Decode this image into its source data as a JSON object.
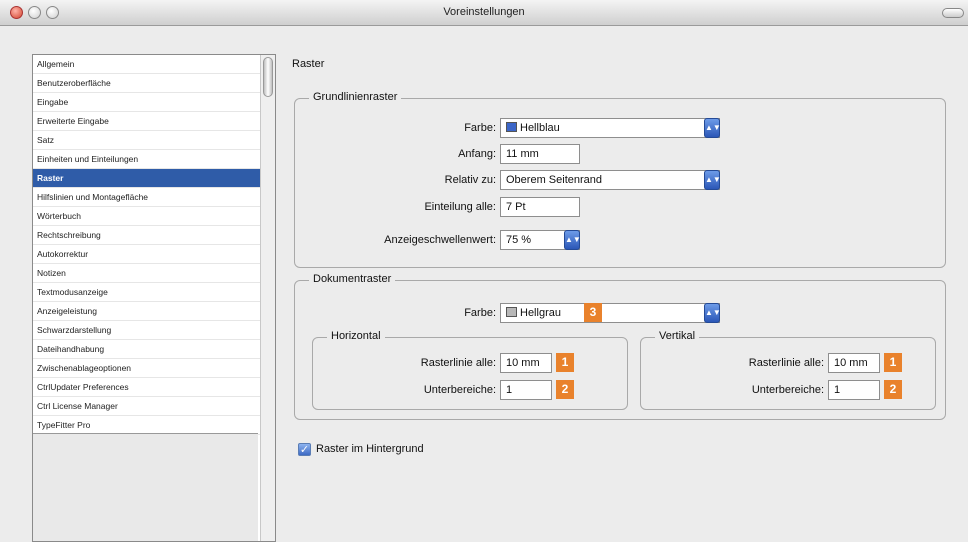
{
  "window": {
    "title": "Voreinstellungen"
  },
  "sidebar": {
    "items": [
      "Allgemein",
      "Benutzeroberfläche",
      "Eingabe",
      "Erweiterte Eingabe",
      "Satz",
      "Einheiten und Einteilungen",
      "Raster",
      "Hilfslinien und Montagefläche",
      "Wörterbuch",
      "Rechtschreibung",
      "Autokorrektur",
      "Notizen",
      "Textmodusanzeige",
      "Anzeigeleistung",
      "Schwarzdarstellung",
      "Dateihandhabung",
      "Zwischenablageoptionen",
      "CtrlUpdater Preferences",
      "Ctrl License Manager",
      "TypeFitter Pro"
    ],
    "selected_index": 6
  },
  "panel": {
    "title": "Raster",
    "baseline": {
      "title": "Grundlinienraster",
      "color_label": "Farbe:",
      "color_value": "Hellblau",
      "color_swatch": "#3c66c8",
      "start_label": "Anfang:",
      "start_value": "11 mm",
      "relative_label": "Relativ zu:",
      "relative_value": "Oberem Seitenrand",
      "increment_label": "Einteilung alle:",
      "increment_value": "7 Pt",
      "threshold_label": "Anzeigeschwellenwert:",
      "threshold_value": "75 %"
    },
    "document": {
      "title": "Dokumentraster",
      "color_label": "Farbe:",
      "color_value": "Hellgrau",
      "color_swatch": "#b8b8b8",
      "badge_color": "3",
      "horizontal": {
        "title": "Horizontal",
        "gridline_label": "Rasterlinie alle:",
        "gridline_value": "10 mm",
        "sub_label": "Unterbereiche:",
        "sub_value": "1",
        "badge_gridline": "1",
        "badge_sub": "2"
      },
      "vertical": {
        "title": "Vertikal",
        "gridline_label": "Rasterlinie alle:",
        "gridline_value": "10 mm",
        "sub_label": "Unterbereiche:",
        "sub_value": "1",
        "badge_gridline": "1",
        "badge_sub": "2"
      }
    },
    "background_checkbox": {
      "label": "Raster im Hintergrund",
      "checked": true
    }
  },
  "colors": {
    "accent": "#2f5ca8",
    "badge": "#e9822c"
  }
}
